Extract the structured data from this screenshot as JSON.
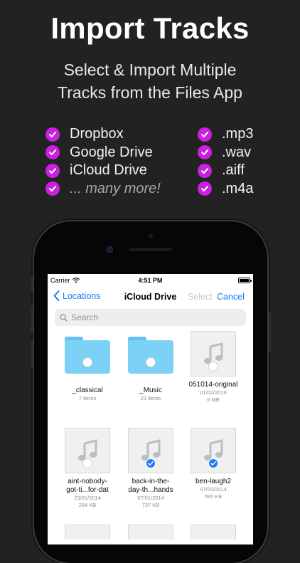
{
  "headline": "Import Tracks",
  "subhead_line1": "Select & Import Multiple",
  "subhead_line2": "Tracks from the Files App",
  "services": [
    {
      "label": "Dropbox"
    },
    {
      "label": "Google Drive"
    },
    {
      "label": "iCloud Drive"
    },
    {
      "label": "... many more!"
    }
  ],
  "formats": [
    {
      "label": ".mp3"
    },
    {
      "label": ".wav"
    },
    {
      "label": ".aiff"
    },
    {
      "label": ".m4a"
    }
  ],
  "status_bar": {
    "carrier": "Carrier",
    "time": "4:51 PM",
    "battery_percent": 100
  },
  "nav": {
    "back_label": "Locations",
    "title": "iCloud Drive",
    "select_label": "Select",
    "cancel_label": "Cancel"
  },
  "search": {
    "placeholder": "Search"
  },
  "items": [
    {
      "name": "_classical",
      "meta1": "7 items",
      "meta2": "",
      "kind": "folder",
      "selected": false
    },
    {
      "name": "_Music",
      "meta1": "21 items",
      "meta2": "",
      "kind": "folder",
      "selected": false
    },
    {
      "name": "051014-original",
      "meta1": "01/02/2016",
      "meta2": "6 MB",
      "kind": "audio",
      "selected": false
    },
    {
      "name": "aint-nobody-got-ti...for-dat",
      "name_line1": "aint-nobody-",
      "name_line2": "got-ti...for-dat",
      "meta1": "23/01/2014",
      "meta2": "264 KB",
      "kind": "audio",
      "selected": false
    },
    {
      "name": "back-in-the-day-th...hands",
      "name_line1": "back-in-the-",
      "name_line2": "day-th...hands",
      "meta1": "07/01/2014",
      "meta2": "737 KB",
      "kind": "audio",
      "selected": true
    },
    {
      "name": "ben-laugh2",
      "meta1": "07/03/2014",
      "meta2": "595 KB",
      "kind": "audio",
      "selected": true
    }
  ],
  "colors": {
    "accent_check": "#c822dc",
    "ios_blue": "#1b7cf5",
    "folder_blue": "#7dd1f7",
    "background": "#222222"
  }
}
